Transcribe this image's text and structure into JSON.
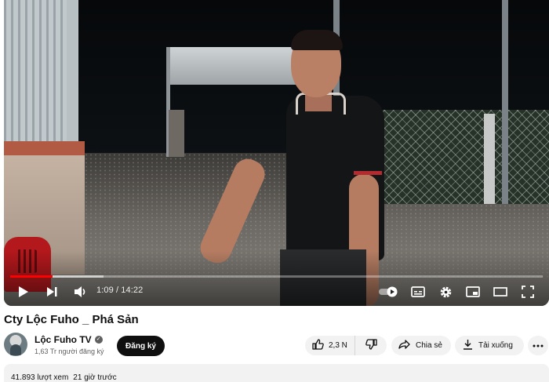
{
  "video": {
    "time_current": "1:09",
    "time_separator": " / ",
    "time_total": "14:22",
    "progress_fraction": 0.08,
    "buffered_fraction": 0.175,
    "accent_color": "#ff0000"
  },
  "title": "Cty Lộc Fuho _ Phá Sản",
  "channel": {
    "name": "Lộc Fuho TV",
    "subscribers": "1,63 Tr người đăng ký",
    "subscribe_label": "Đăng ký"
  },
  "actions": {
    "like_count": "2,3 N",
    "share_label": "Chia sẻ",
    "download_label": "Tải xuống"
  },
  "description": {
    "views": "41.893 lượt xem",
    "age": "21 giờ trước"
  },
  "icons": {
    "play": "play-icon",
    "next": "next-icon",
    "volume": "volume-icon",
    "autoplay": "autoplay-toggle-icon",
    "subtitles": "subtitles-icon",
    "settings": "gear-icon",
    "miniplayer": "miniplayer-icon",
    "theater": "theater-icon",
    "fullscreen": "fullscreen-icon",
    "verified": "verified-icon",
    "like": "thumbs-up-icon",
    "dislike": "thumbs-down-icon",
    "share": "share-icon",
    "download": "download-icon",
    "more": "more-icon"
  }
}
